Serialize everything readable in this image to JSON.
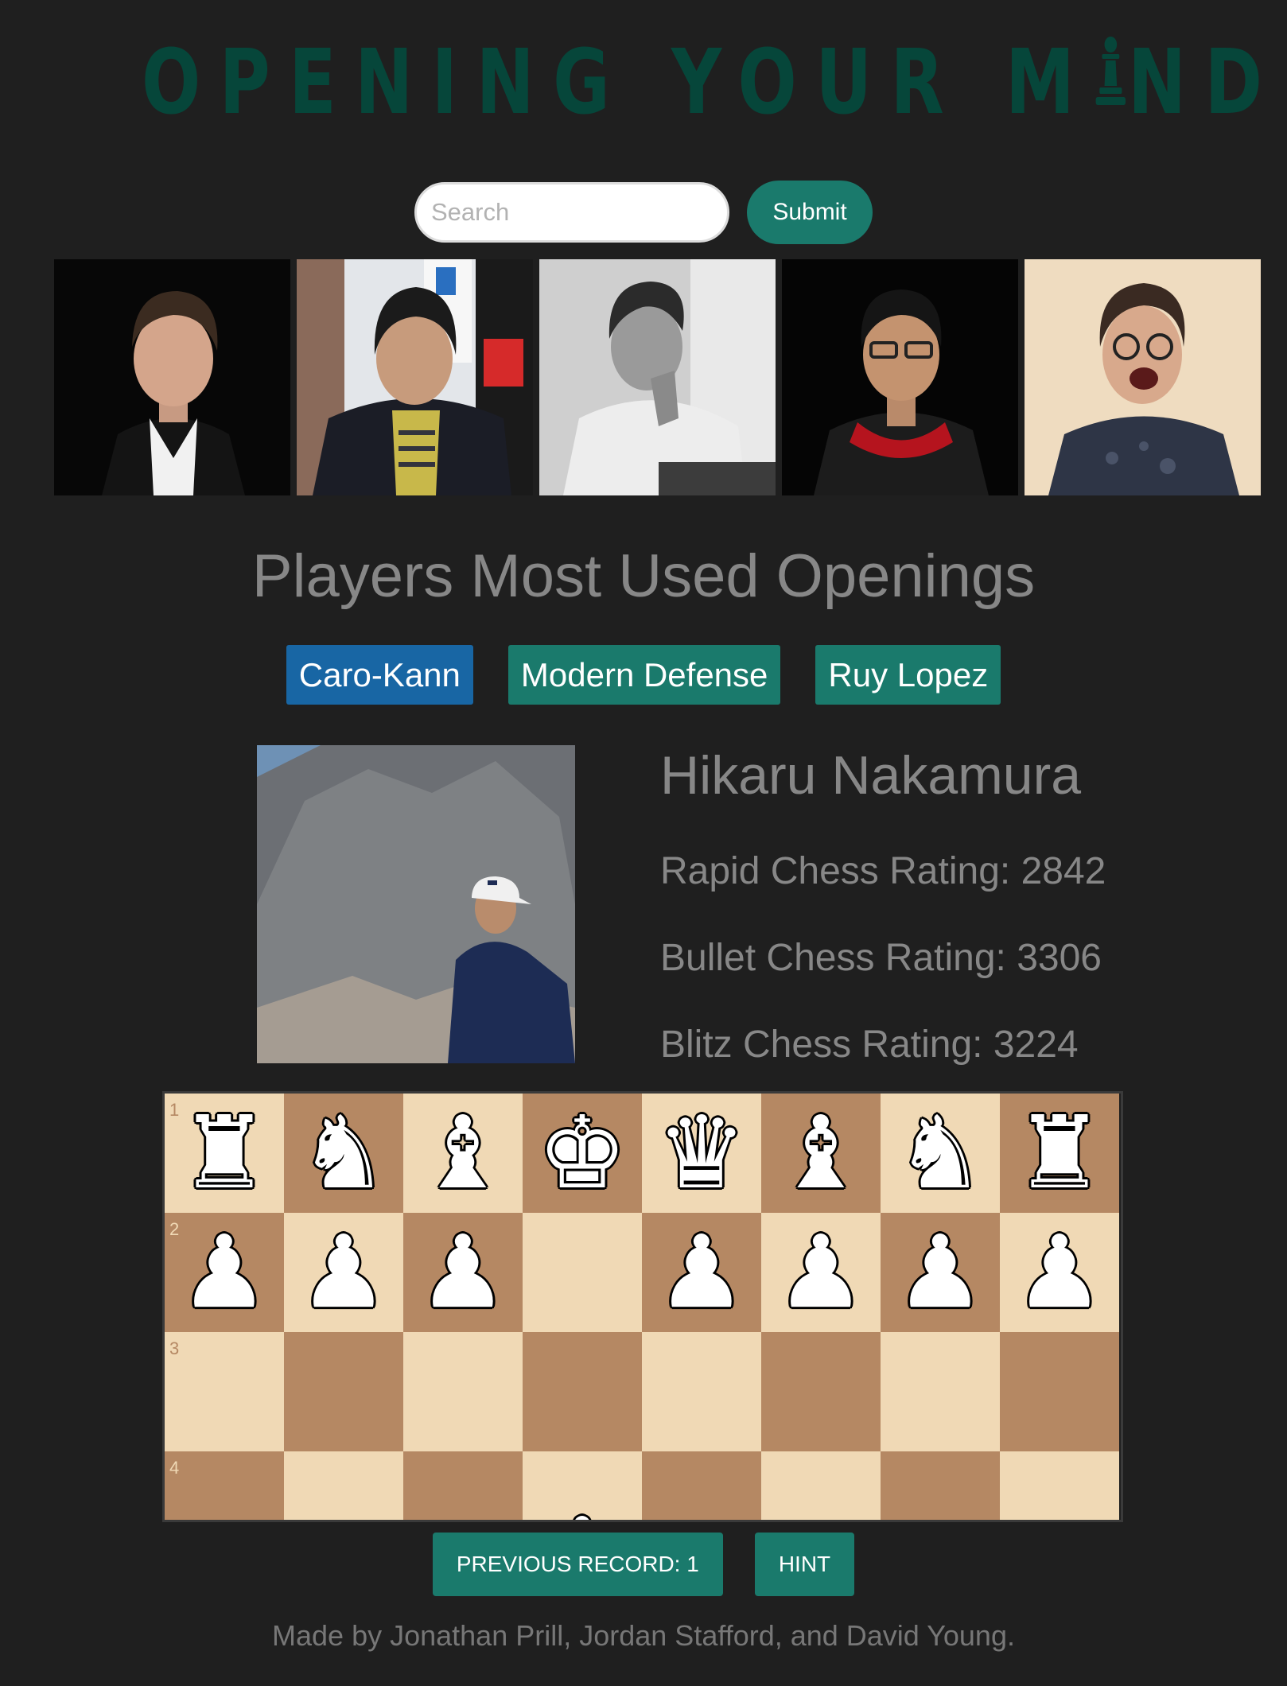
{
  "header": {
    "logo_text_left": "OPENING YOUR M",
    "logo_text_right": "ND",
    "logo_icon": "pawn-icon"
  },
  "search": {
    "placeholder": "Search",
    "value": "",
    "submit_label": "Submit"
  },
  "gallery": {
    "players": [
      {
        "icon": "player-photo-1"
      },
      {
        "icon": "player-photo-2"
      },
      {
        "icon": "player-photo-3"
      },
      {
        "icon": "player-photo-4"
      },
      {
        "icon": "player-photo-5"
      }
    ]
  },
  "openings": {
    "title": "Players Most Used Openings",
    "items": [
      {
        "label": "Caro-Kann",
        "active": true
      },
      {
        "label": "Modern Defense",
        "active": false
      },
      {
        "label": "Ruy Lopez",
        "active": false
      }
    ]
  },
  "player": {
    "name": "Hikaru Nakamura",
    "rapid": "Rapid Chess Rating: 2842",
    "bullet": "Bullet Chess Rating: 3306",
    "blitz": "Blitz Chess Rating: 3224"
  },
  "board": {
    "rank_labels": [
      "1",
      "2",
      "3",
      "4"
    ],
    "rows": [
      [
        "♜",
        "♞",
        "♝",
        "♚",
        "♛",
        "♝",
        "♞",
        "♜"
      ],
      [
        "♟",
        "♟",
        "♟",
        "",
        "♟",
        "♟",
        "♟",
        "♟"
      ],
      [
        "",
        "",
        "",
        "",
        "",
        "",
        "",
        ""
      ],
      [
        "",
        "",
        "",
        "♟",
        "",
        "",
        "",
        ""
      ]
    ],
    "colors": {
      "light": "#f0d9b5",
      "dark": "#b58863"
    }
  },
  "controls": {
    "previous_label": "PREVIOUS RECORD: 1",
    "hint_label": "HINT"
  },
  "footer": {
    "credits": "Made by Jonathan Prill, Jordan Stafford, and David Young."
  },
  "colors": {
    "background": "#1f1f1f",
    "accent": "#1a7a6c",
    "active": "#1866a4",
    "logo": "#06463a"
  }
}
